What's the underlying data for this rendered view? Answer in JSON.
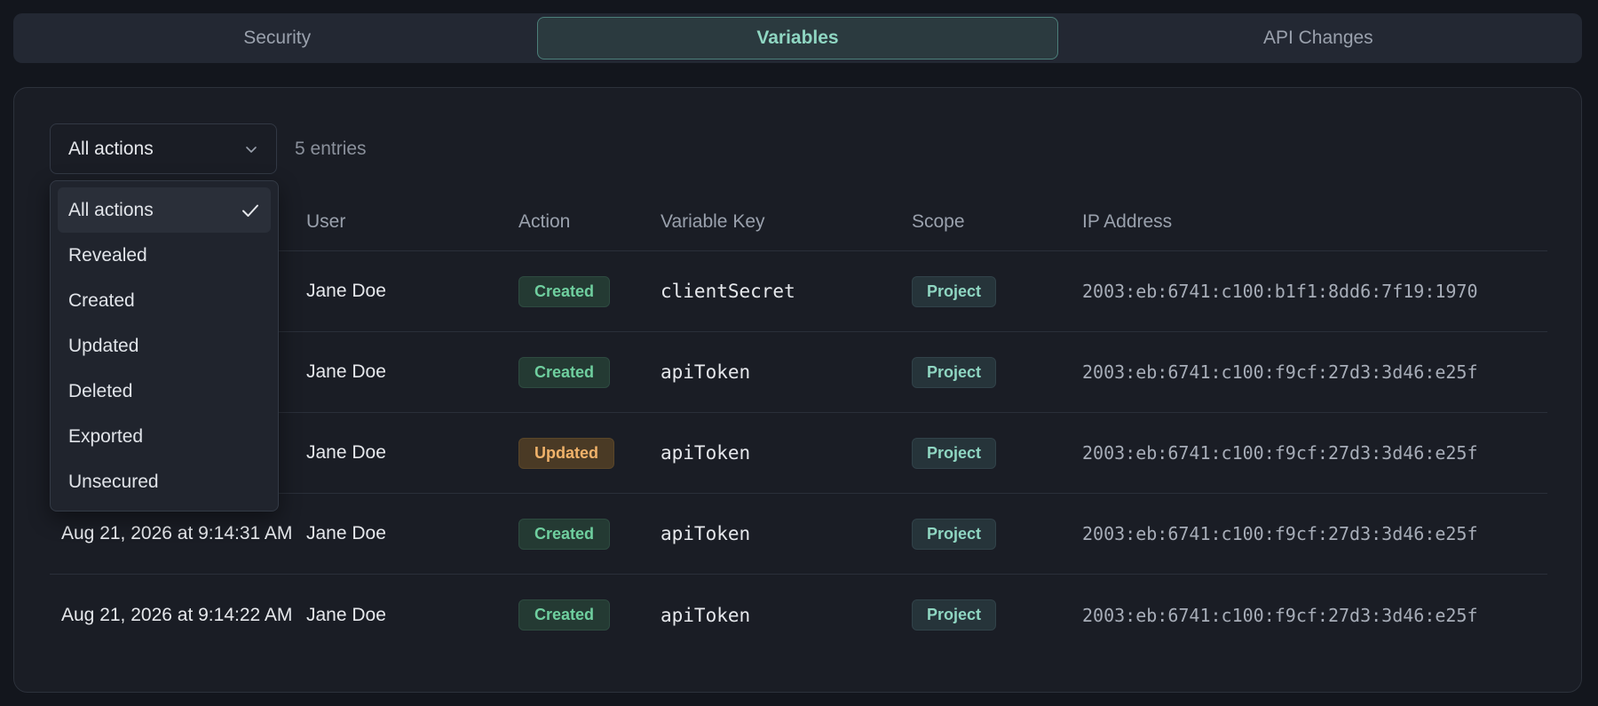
{
  "tabs": [
    {
      "label": "Security"
    },
    {
      "label": "Variables"
    },
    {
      "label": "API Changes"
    }
  ],
  "toolbar": {
    "filter_value": "All actions",
    "entries_label": "5 entries"
  },
  "dropdown": {
    "options": [
      "All actions",
      "Revealed",
      "Created",
      "Updated",
      "Deleted",
      "Exported",
      "Unsecured"
    ],
    "selected": "All actions"
  },
  "table": {
    "headers": {
      "user": "User",
      "action": "Action",
      "key": "Variable Key",
      "scope": "Scope",
      "ip": "IP Address"
    },
    "rows": [
      {
        "time": "",
        "user": "Jane Doe",
        "action": "Created",
        "key": "clientSecret",
        "scope": "Project",
        "ip": "2003:eb:6741:c100:b1f1:8dd6:7f19:1970"
      },
      {
        "time": "",
        "user": "Jane Doe",
        "action": "Created",
        "key": "apiToken",
        "scope": "Project",
        "ip": "2003:eb:6741:c100:f9cf:27d3:3d46:e25f"
      },
      {
        "time": "",
        "user": "Jane Doe",
        "action": "Updated",
        "key": "apiToken",
        "scope": "Project",
        "ip": "2003:eb:6741:c100:f9cf:27d3:3d46:e25f"
      },
      {
        "time": "Aug 21, 2026 at 9:14:31 AM",
        "user": "Jane Doe",
        "action": "Created",
        "key": "apiToken",
        "scope": "Project",
        "ip": "2003:eb:6741:c100:f9cf:27d3:3d46:e25f"
      },
      {
        "time": "Aug 21, 2026 at 9:14:22 AM",
        "user": "Jane Doe",
        "action": "Created",
        "key": "apiToken",
        "scope": "Project",
        "ip": "2003:eb:6741:c100:f9cf:27d3:3d46:e25f"
      }
    ]
  },
  "colors": {
    "accent": "#8fd6c2",
    "created": "#6fcf9f",
    "updated": "#f0b26a"
  }
}
